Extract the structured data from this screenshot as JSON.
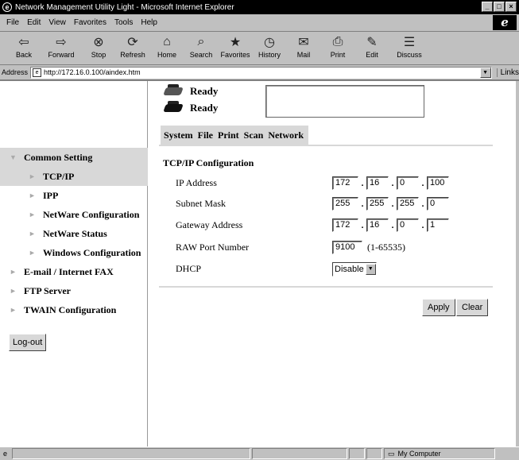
{
  "window": {
    "title": "Network Management Utility Light - Microsoft Internet Explorer"
  },
  "menu": [
    "File",
    "Edit",
    "View",
    "Favorites",
    "Tools",
    "Help"
  ],
  "toolbar": [
    {
      "label": "Back",
      "icon": "back-arrow-icon",
      "glyph": "⇦"
    },
    {
      "label": "Forward",
      "icon": "forward-arrow-icon",
      "glyph": "⇨"
    },
    {
      "label": "Stop",
      "icon": "stop-icon",
      "glyph": "⊗"
    },
    {
      "label": "Refresh",
      "icon": "refresh-icon",
      "glyph": "⟳"
    },
    {
      "label": "Home",
      "icon": "home-icon",
      "glyph": "⌂"
    },
    {
      "label": "Search",
      "icon": "search-icon",
      "glyph": "⌕"
    },
    {
      "label": "Favorites",
      "icon": "favorites-icon",
      "glyph": "★"
    },
    {
      "label": "History",
      "icon": "history-icon",
      "glyph": "◷"
    },
    {
      "label": "Mail",
      "icon": "mail-icon",
      "glyph": "✉"
    },
    {
      "label": "Print",
      "icon": "print-icon",
      "glyph": "⎙"
    },
    {
      "label": "Edit",
      "icon": "edit-icon",
      "glyph": "✎"
    },
    {
      "label": "Discuss",
      "icon": "discuss-icon",
      "glyph": "☰"
    }
  ],
  "address": {
    "label": "Address",
    "url": "http://172.16.0.100/aindex.htm",
    "links_label": "Links"
  },
  "status": [
    {
      "text": "Ready"
    },
    {
      "text": "Ready"
    }
  ],
  "tabs": [
    "System",
    "File",
    "Print",
    "Scan",
    "Network"
  ],
  "sidebar": {
    "sections": [
      {
        "label": "Common Setting"
      },
      {
        "label": "E-mail / Internet FAX"
      },
      {
        "label": "FTP Server"
      },
      {
        "label": "TWAIN Configuration"
      }
    ],
    "sub_items": [
      "TCP/IP",
      "IPP",
      "NetWare Configuration",
      "NetWare Status",
      "Windows Configuration"
    ],
    "logout_label": "Log-out"
  },
  "config": {
    "title": "TCP/IP Configuration",
    "ip_label": "IP Address",
    "ip": [
      "172",
      "16",
      "0",
      "100"
    ],
    "mask_label": "Subnet Mask",
    "mask": [
      "255",
      "255",
      "255",
      "0"
    ],
    "gateway_label": "Gateway Address",
    "gateway": [
      "172",
      "16",
      "0",
      "1"
    ],
    "raw_label": "RAW Port Number",
    "raw_port": "9100",
    "raw_range": "(1-65535)",
    "dhcp_label": "DHCP",
    "dhcp_value": "Disable"
  },
  "buttons": {
    "apply": "Apply",
    "clear": "Clear"
  },
  "statusbar": {
    "zone": "My Computer"
  }
}
